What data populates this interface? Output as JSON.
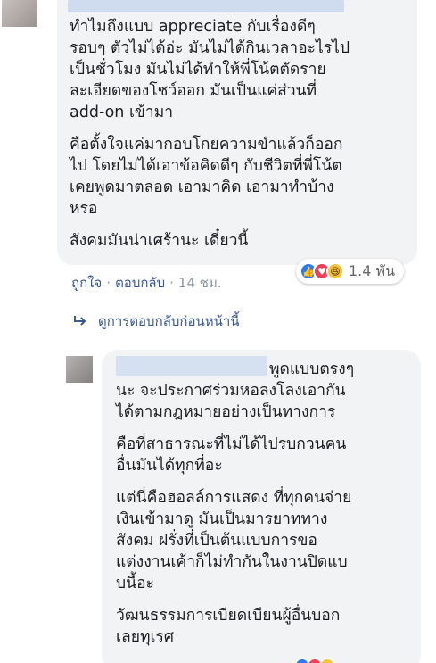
{
  "comment1": {
    "paragraphs": [
      "ทำไมถึงแบบ appreciate กับเรื่องดีๆ\nรอบๆ ตัวไม่ได้อ่ะ มันไม่ได้กินเวลาอะไรไป\nเป็นชั่วโมง มันไม่ได้ทำให้พี่โน้ตตัดราย\nละเอียดของโชว์ออก มันเป็นแค่ส่วนที่\nadd-on เข้ามา",
      "คือตั้งใจแค่มากอบโกยความขำแล้วก็ออก\nไป โดยไม่ได้เอาข้อคิดดีๆ กับชีวิตที่พี่โน้ต\nเคยพูดมาตลอด เอามาคิด เอามาทำบ้าง\nหรอ",
      "สังคมมันน่าเศร้านะ เดี๋ยวนี้"
    ],
    "reactions": {
      "icons": [
        "like",
        "love",
        "haha"
      ],
      "count": "1.4 พัน"
    },
    "actions": {
      "like": "ถูกใจ",
      "reply": "ตอบกลับ",
      "time": "14 ชม."
    }
  },
  "view_previous": "ดูการตอบกลับก่อนหน้านี้",
  "comment2": {
    "first_line": "พูดแบบตรงๆ",
    "paragraphs": [
      "นะ จะประกาศร่วมหอลงโลงเอากัน\nได้ตามกฎหมายอย่างเป็นทางการ",
      "คือที่สาธารณะที่ไม่ได้ไปรบกวนคน\nอื่นมันได้ทุกที่อะ",
      "แต่นี่คือฮอลล์การแสดง ที่ทุกคนจ่าย\nเงินเข้ามาดู มันเป็นมารยาททาง\nสังคม ฝรั่งที่เป็นต้นแบบการขอ\nแต่งงานเค้าก็ไม่ทำกันในงานปิดแบ\nบนี้อะ",
      "วัฒนธรรมการเบียดเบียนผู้อื่นบอก\nเลยทุเรศ"
    ]
  },
  "colors": {
    "bubble": "#f2f3f5",
    "link": "#385898",
    "meta": "#8d949e"
  }
}
